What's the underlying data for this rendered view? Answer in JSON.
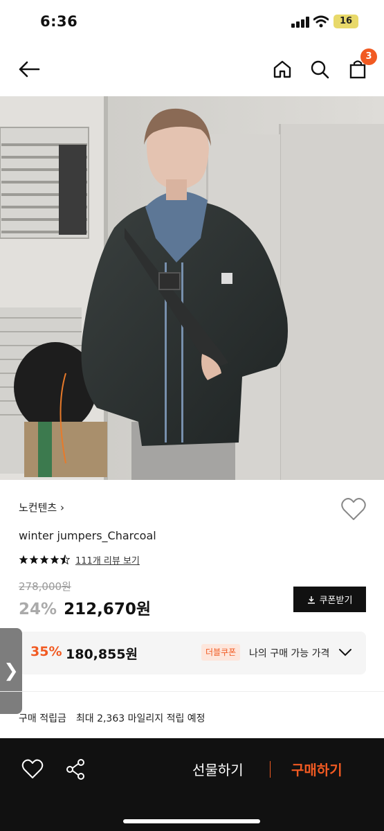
{
  "status_bar": {
    "time": "6:36",
    "battery": "16"
  },
  "nav": {
    "cart_count": "3"
  },
  "product": {
    "brand": "노컨텐츠",
    "brand_arrow": "›",
    "name": "winter jumpers_Charcoal",
    "rating": 4.5,
    "review_link": "111개 리뷰 보기",
    "original_price": "278,000원",
    "discount": "24%",
    "price": "212,670원",
    "coupon_button": "쿠폰받기"
  },
  "double_coupon": {
    "discount": "35%",
    "price": "180,855원",
    "badge": "더블쿠폰",
    "label": "나의 구매 가능 가격"
  },
  "side_tab": {
    "glyph": "❯"
  },
  "points": {
    "label": "구매 적립금",
    "value": "최대 2,363 마일리지 적립 예정"
  },
  "bottom_bar": {
    "gift": "선물하기",
    "buy": "구매하기"
  },
  "colors": {
    "accent": "#f15a22",
    "dark": "#111111"
  }
}
